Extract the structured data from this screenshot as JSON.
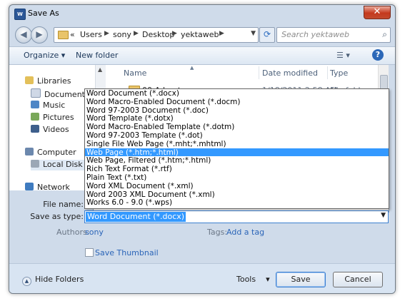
{
  "window": {
    "title": "Save As",
    "app_icon_text": "W"
  },
  "address": {
    "crumbs": [
      "Users",
      "sony",
      "Desktop",
      "yektaweb"
    ],
    "leading_chevron": "«",
    "search_placeholder": "Search yektaweb"
  },
  "toolbar": {
    "organize_label": "Organize ▾",
    "new_folder_label": "New folder"
  },
  "sidebar": {
    "items": [
      {
        "label": "Libraries",
        "icon": "libraries-icon"
      },
      {
        "label": "Documents",
        "icon": "documents-icon"
      },
      {
        "label": "Music",
        "icon": "music-icon"
      },
      {
        "label": "Pictures",
        "icon": "pictures-icon"
      },
      {
        "label": "Videos",
        "icon": "videos-icon"
      },
      {
        "label": "Computer",
        "icon": "computer-icon"
      },
      {
        "label": "Local Disk (C:)",
        "icon": "drive-icon"
      },
      {
        "label": "Network",
        "icon": "network-icon"
      }
    ]
  },
  "file_list": {
    "columns": [
      "Name",
      "Date modified",
      "Type"
    ],
    "rows": [
      {
        "name": "00-Adverts",
        "date": "1/18/2011 2:58 AM",
        "type": "File folder"
      }
    ]
  },
  "form": {
    "file_name_label": "File name:",
    "save_type_label": "Save as type:",
    "save_type_value": "Word Document (*.docx)",
    "authors_label": "Authors:",
    "authors_value": "sony",
    "tags_label": "Tags:",
    "tags_value": "Add a tag",
    "thumbnail_label": "Save Thumbnail"
  },
  "dropdown": {
    "options": [
      "Word Document (*.docx)",
      "Word Macro-Enabled Document (*.docm)",
      "Word 97-2003 Document (*.doc)",
      "Word Template (*.dotx)",
      "Word Macro-Enabled Template (*.dotm)",
      "Word 97-2003 Template (*.dot)",
      "Single File Web Page (*.mht;*.mhtml)",
      "Web Page (*.htm;*.html)",
      "Web Page, Filtered (*.htm;*.html)",
      "Rich Text Format (*.rtf)",
      "Plain Text (*.txt)",
      "Word XML Document (*.xml)",
      "Word 2003 XML Document (*.xml)",
      "Works 6.0 - 9.0 (*.wps)"
    ],
    "highlighted": "Web Page (*.htm;*.html)"
  },
  "footer": {
    "hide_folders_label": "Hide Folders",
    "tools_label": "Tools",
    "save_label": "Save",
    "cancel_label": "Cancel"
  },
  "colors": {
    "accent": "#3399ff",
    "link": "#2b65b8",
    "frame": "#cfdbea"
  }
}
